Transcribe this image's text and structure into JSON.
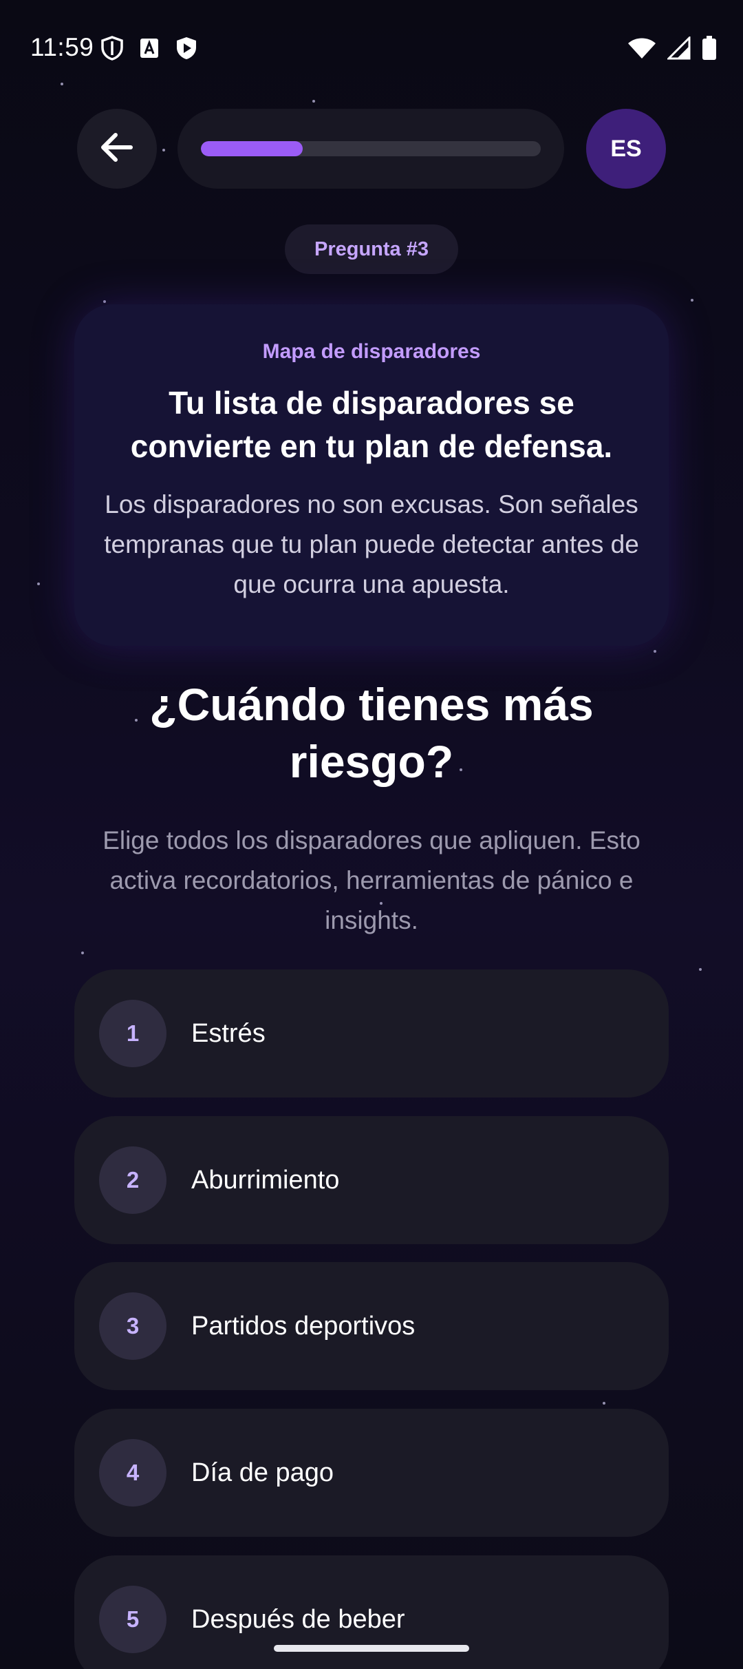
{
  "status_bar": {
    "time": "11:59",
    "left_icons": [
      "shield-icon",
      "font-icon",
      "play-shield-icon"
    ],
    "right_icons": [
      "wifi-icon",
      "signal-icon",
      "battery-icon"
    ]
  },
  "header": {
    "back_icon": "arrow-left-icon",
    "progress": 0.3,
    "language": "ES"
  },
  "question_badge": "Pregunta #3",
  "info_card": {
    "eyebrow": "Mapa de disparadores",
    "title": "Tu lista de disparadores se convierte en tu plan de defensa.",
    "body": "Los disparadores no son excusas. Son señales tempranas que tu plan puede detectar antes de que ocurra una apuesta."
  },
  "question": {
    "title": "¿Cuándo tienes más riesgo?",
    "subtitle": "Elige todos los disparadores que apliquen. Esto activa recordatorios, herramientas de pánico e insights."
  },
  "options": [
    {
      "number": "1",
      "label": "Estrés"
    },
    {
      "number": "2",
      "label": "Aburrimiento"
    },
    {
      "number": "3",
      "label": "Partidos deportivos"
    },
    {
      "number": "4",
      "label": "Día de pago"
    },
    {
      "number": "5",
      "label": "Después de beber"
    }
  ],
  "colors": {
    "accent": "#9b5cf6",
    "lang_bg": "#3e1f7a",
    "eyebrow": "#c39cff",
    "background": "#0b0a16"
  }
}
